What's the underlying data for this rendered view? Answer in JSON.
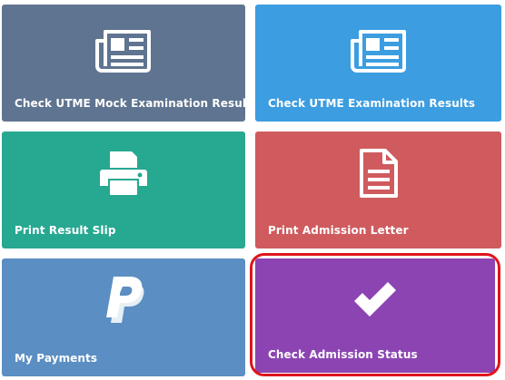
{
  "tiles": [
    {
      "label": "Check UTME Mock Examination Results",
      "icon": "newspaper-icon",
      "color": "#5f7490"
    },
    {
      "label": "Check UTME Examination Results",
      "icon": "newspaper-icon",
      "color": "#3c9de0"
    },
    {
      "label": "Print Result Slip",
      "icon": "printer-icon",
      "color": "#27a891"
    },
    {
      "label": "Print Admission Letter",
      "icon": "document-icon",
      "color": "#cf5b5e"
    },
    {
      "label": "My Payments",
      "icon": "paypal-icon",
      "color": "#5b8ec2"
    },
    {
      "label": "Check Admission Status",
      "icon": "checkmark-icon",
      "color": "#8c44b3"
    }
  ],
  "highlight_color": "#e0141c"
}
